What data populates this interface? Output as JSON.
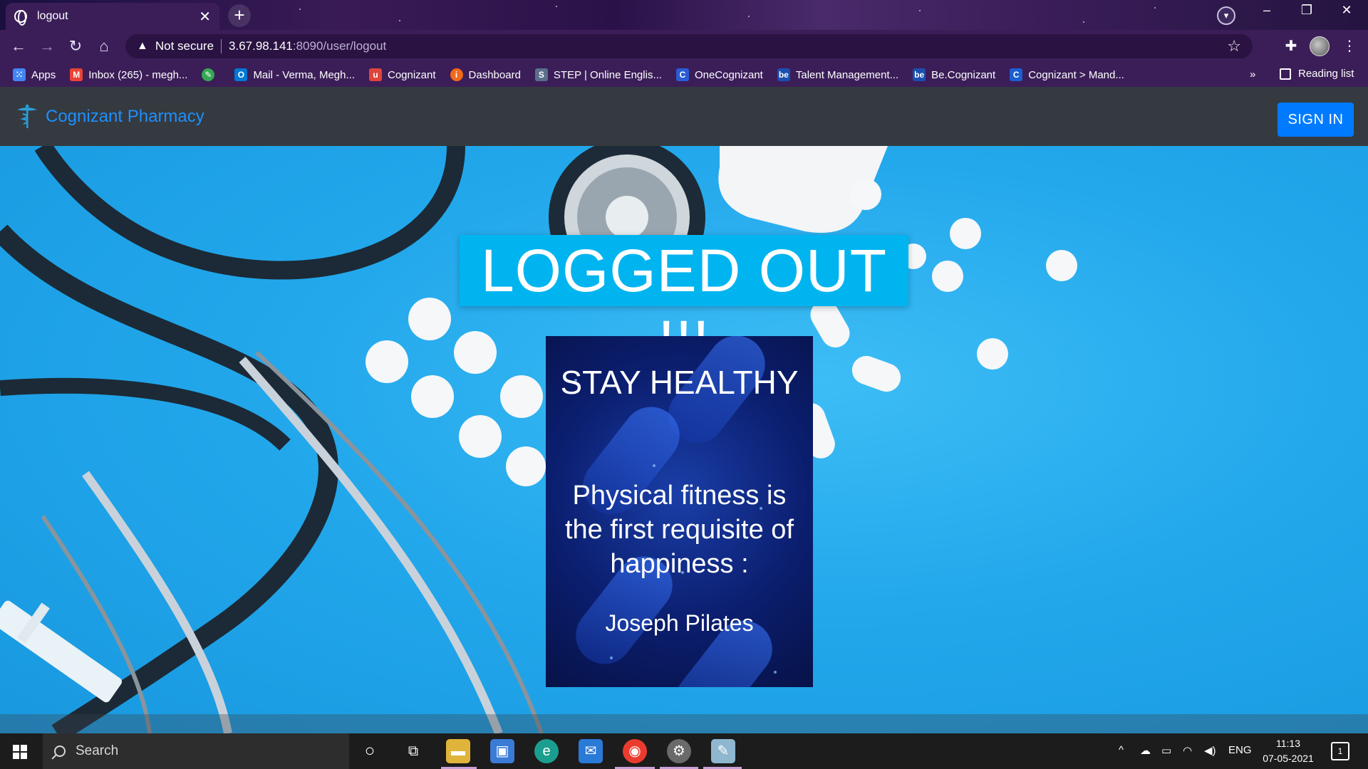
{
  "browser": {
    "tab_title": "logout",
    "tab_close": "✕",
    "new_tab": "+",
    "profile_badge": "▾",
    "url_warning": "Not secure",
    "url_host": "3.67.98.141",
    "url_path": ":8090/user/logout",
    "window_controls": {
      "minimize": "–",
      "restore": "❐",
      "close": "✕"
    },
    "bookmarks": [
      {
        "label": "Apps",
        "icon": "apps-grid-icon",
        "color": "#e8e8e8"
      },
      {
        "label": "Inbox (265) - megh...",
        "icon": "gmail-icon",
        "color": "#ea4335"
      },
      {
        "label": "",
        "icon": "green-leaf-icon",
        "color": "#34a853"
      },
      {
        "label": "Mail - Verma, Megh...",
        "icon": "outlook-icon",
        "color": "#0078d4"
      },
      {
        "label": "Cognizant",
        "icon": "cognizant-u-icon",
        "color": "#e0443a"
      },
      {
        "label": "Dashboard",
        "icon": "dashboard-icon",
        "color": "#f06a1a"
      },
      {
        "label": "STEP | Online Englis...",
        "icon": "step-icon",
        "color": "#5a6f8a"
      },
      {
        "label": "OneCognizant",
        "icon": "onecognizant-icon",
        "color": "#2a5cd6"
      },
      {
        "label": "Talent Management...",
        "icon": "be-icon",
        "color": "#1a4fb0"
      },
      {
        "label": "Be.Cognizant",
        "icon": "be-icon",
        "color": "#1a4fb0"
      },
      {
        "label": "Cognizant > Mand...",
        "icon": "cognizant-c-icon",
        "color": "#1a5fd0"
      }
    ],
    "bookmarks_more": "»",
    "reading_list": "Reading list"
  },
  "app": {
    "brand_name": "Cognizant Pharmacy",
    "signin_label": "SIGN IN",
    "headline": "LOGGED OUT !!!",
    "card_title": "STAY HEALTHY",
    "card_quote": "Physical fitness is the first requisite of happiness :",
    "card_author": "Joseph Pilates",
    "colors": {
      "navbar": "#343a40",
      "brand": "#1e90ff",
      "signin": "#007bff",
      "headline_bg": "#00b4f0",
      "hero_bg": "#23a8ec"
    }
  },
  "taskbar": {
    "search_placeholder": "Search",
    "language": "ENG",
    "time": "11:13",
    "date": "07-05-2021",
    "notification_count": "1"
  }
}
